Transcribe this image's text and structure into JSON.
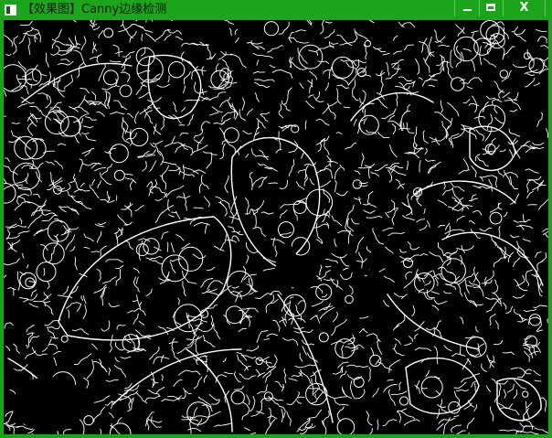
{
  "window": {
    "title": "【效果图】Canny边缘检测",
    "controls": {
      "minimize": "minimize-icon",
      "maximize": "maximize-icon",
      "close": "close-icon"
    }
  },
  "image": {
    "description_kind": "canny-edge-map",
    "edge_color": "#ffffff",
    "background_color": "#000000"
  }
}
